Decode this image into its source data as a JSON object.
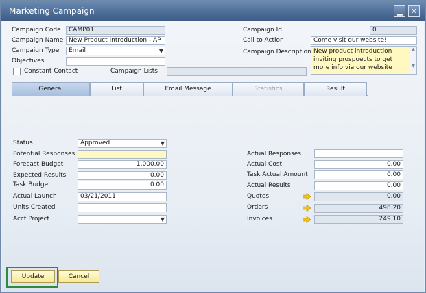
{
  "window": {
    "title": "Marketing Campaign"
  },
  "header_left": {
    "campaign_code": {
      "label": "Campaign Code",
      "value": "CAMP01"
    },
    "campaign_name": {
      "label": "Campaign Name",
      "value": "New Product Introduction - AP"
    },
    "campaign_type": {
      "label": "Campaign Type",
      "value": "Email"
    },
    "objectives": {
      "label": "Objectives",
      "value": ""
    },
    "constant_contact": {
      "label": "Constant Contact",
      "checked": false
    },
    "campaign_lists": {
      "label": "Campaign Lists",
      "value": ""
    }
  },
  "header_right": {
    "campaign_id": {
      "label": "Campaign Id",
      "value": "0"
    },
    "call_to_action": {
      "label": "Call to Action",
      "value": "Come visit our website!"
    },
    "campaign_description": {
      "label": "Campaign Description",
      "lines": [
        "New product introduction",
        "inviting prospoects to get",
        "more info via our website"
      ]
    }
  },
  "tabs": [
    {
      "label": "General",
      "active": true,
      "disabled": false
    },
    {
      "label": "List",
      "active": false,
      "disabled": false
    },
    {
      "label": "Email Message",
      "active": false,
      "disabled": false
    },
    {
      "label": "Statistics",
      "active": false,
      "disabled": true
    },
    {
      "label": "Result",
      "active": false,
      "disabled": false
    }
  ],
  "general_left": {
    "status": {
      "label": "Status",
      "value": "Approved"
    },
    "potential_responses": {
      "label": "Potential Responses",
      "value": ""
    },
    "forecast_budget": {
      "label": "Forecast Budget",
      "value": "1,000.00"
    },
    "expected_results": {
      "label": "Expected Results",
      "value": "0.00"
    },
    "task_budget": {
      "label": "Task Budget",
      "value": "0.00"
    },
    "actual_launch": {
      "label": "Actual Launch",
      "value": "03/21/2011"
    },
    "units_created": {
      "label": "Units Created",
      "value": ""
    },
    "acct_project": {
      "label": "Acct Project",
      "value": ""
    }
  },
  "general_right": {
    "actual_responses": {
      "label": "Actual Responses",
      "value": ""
    },
    "actual_cost": {
      "label": "Actual Cost",
      "value": "0.00"
    },
    "task_actual_amount": {
      "label": "Task Actual Amount",
      "value": "0.00"
    },
    "actual_results": {
      "label": "Actual Results",
      "value": "0.00"
    },
    "quotes": {
      "label": "Quotes",
      "value": "0.00"
    },
    "orders": {
      "label": "Orders",
      "value": "498.20"
    },
    "invoices": {
      "label": "Invoices",
      "value": "249.10"
    }
  },
  "buttons": {
    "update": "Update",
    "cancel": "Cancel"
  },
  "icons": {
    "link_arrow": "link-arrow-icon",
    "minimize": "minimize-icon",
    "close": "close-icon"
  },
  "colors": {
    "yellow_field": "#fff8c0",
    "button_bg": "#f8e98f",
    "focus_ring": "#2f8a3a"
  }
}
